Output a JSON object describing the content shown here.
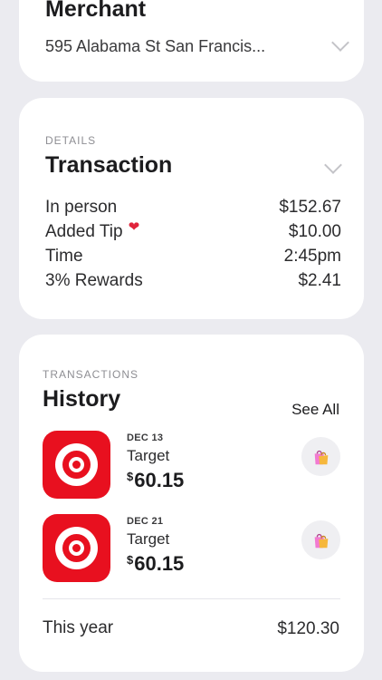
{
  "merchant": {
    "title": "Merchant",
    "address": "595 Alabama St San Francis..."
  },
  "details": {
    "eyebrow": "DETAILS",
    "title": "Transaction",
    "rows": [
      {
        "label": "In person",
        "value": "$152.67"
      },
      {
        "label": "Added Tip",
        "value": "$10.00",
        "icon": "heart-icon"
      },
      {
        "label": "Time",
        "value": "2:45pm"
      },
      {
        "label": "3% Rewards",
        "value": "$2.41"
      }
    ]
  },
  "history": {
    "eyebrow": "TRANSACTIONS",
    "title": "History",
    "see_all": "See All",
    "items": [
      {
        "date": "DEC 13",
        "merchant": "Target",
        "currency": "$",
        "amount": "60.15",
        "icon": "shopping-bags-icon"
      },
      {
        "date": "DEC 21",
        "merchant": "Target",
        "currency": "$",
        "amount": "60.15",
        "icon": "shopping-bags-icon"
      }
    ],
    "total_label": "This year",
    "total_value": "$120.30"
  },
  "colors": {
    "background": "#ebebf0",
    "card": "#ffffff",
    "target_red": "#e8101f",
    "heart": "#e0243b",
    "bag_pink": "#f27ad1"
  }
}
